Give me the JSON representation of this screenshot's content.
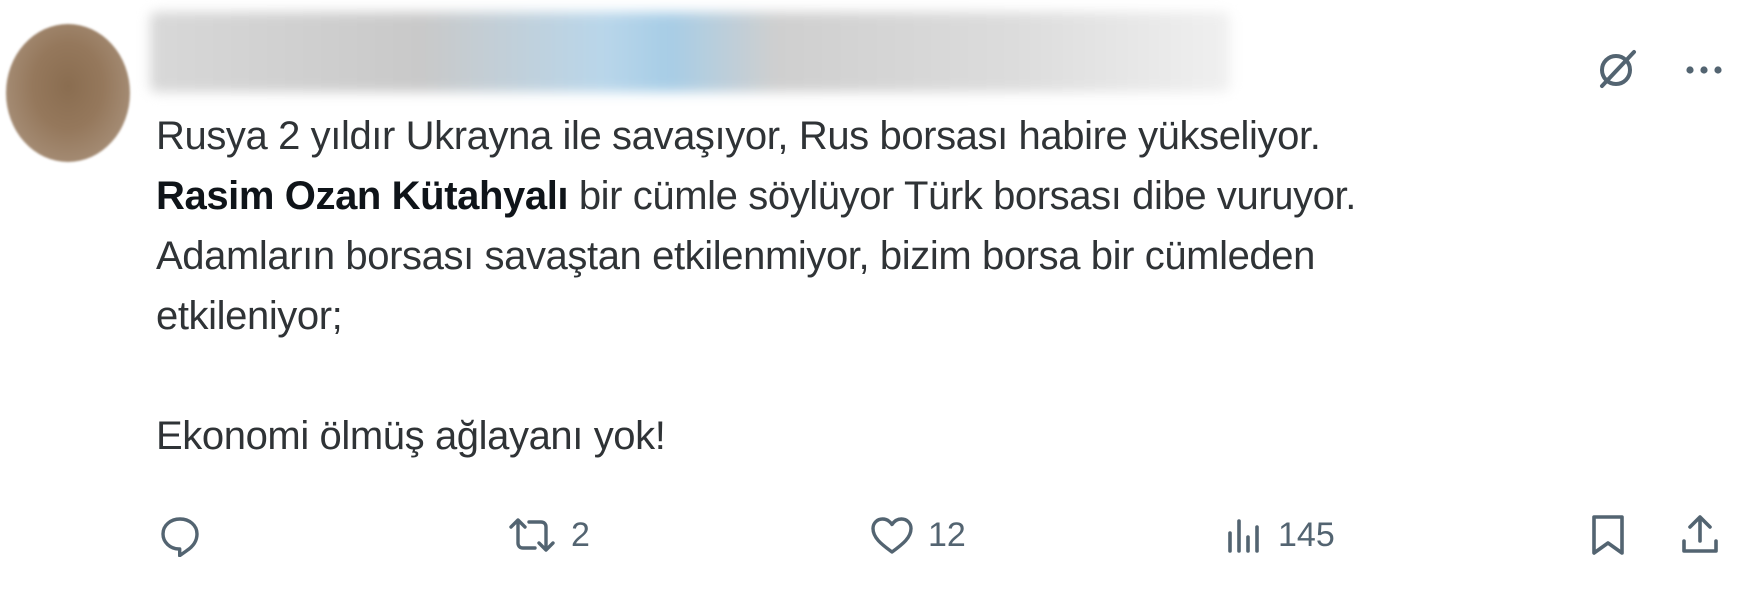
{
  "tweet": {
    "author_avatar_icon": "avatar-blurred",
    "header_icons": [
      "grok-icon",
      "more-icon"
    ],
    "body": {
      "line1": "Rusya 2 yıldır Ukrayna ile savaşıyor, Rus borsası habire yükseliyor.",
      "mention": "Rasim Ozan Kütahyalı",
      "line2_rest": " bir cümle söylüyor Türk borsası dibe vuruyor.",
      "line3": "Adamların borsası savaştan etkilenmiyor, bizim borsa bir cümleden",
      "line4": "etkileniyor;",
      "line5": "Ekonomi ölmüş ağlayanı yok!"
    },
    "actions": {
      "reply_icon": "reply-icon",
      "repost_count": "2",
      "like_count": "12",
      "views_count": "145",
      "bookmark_icon": "bookmark-icon",
      "share_icon": "share-icon"
    }
  }
}
